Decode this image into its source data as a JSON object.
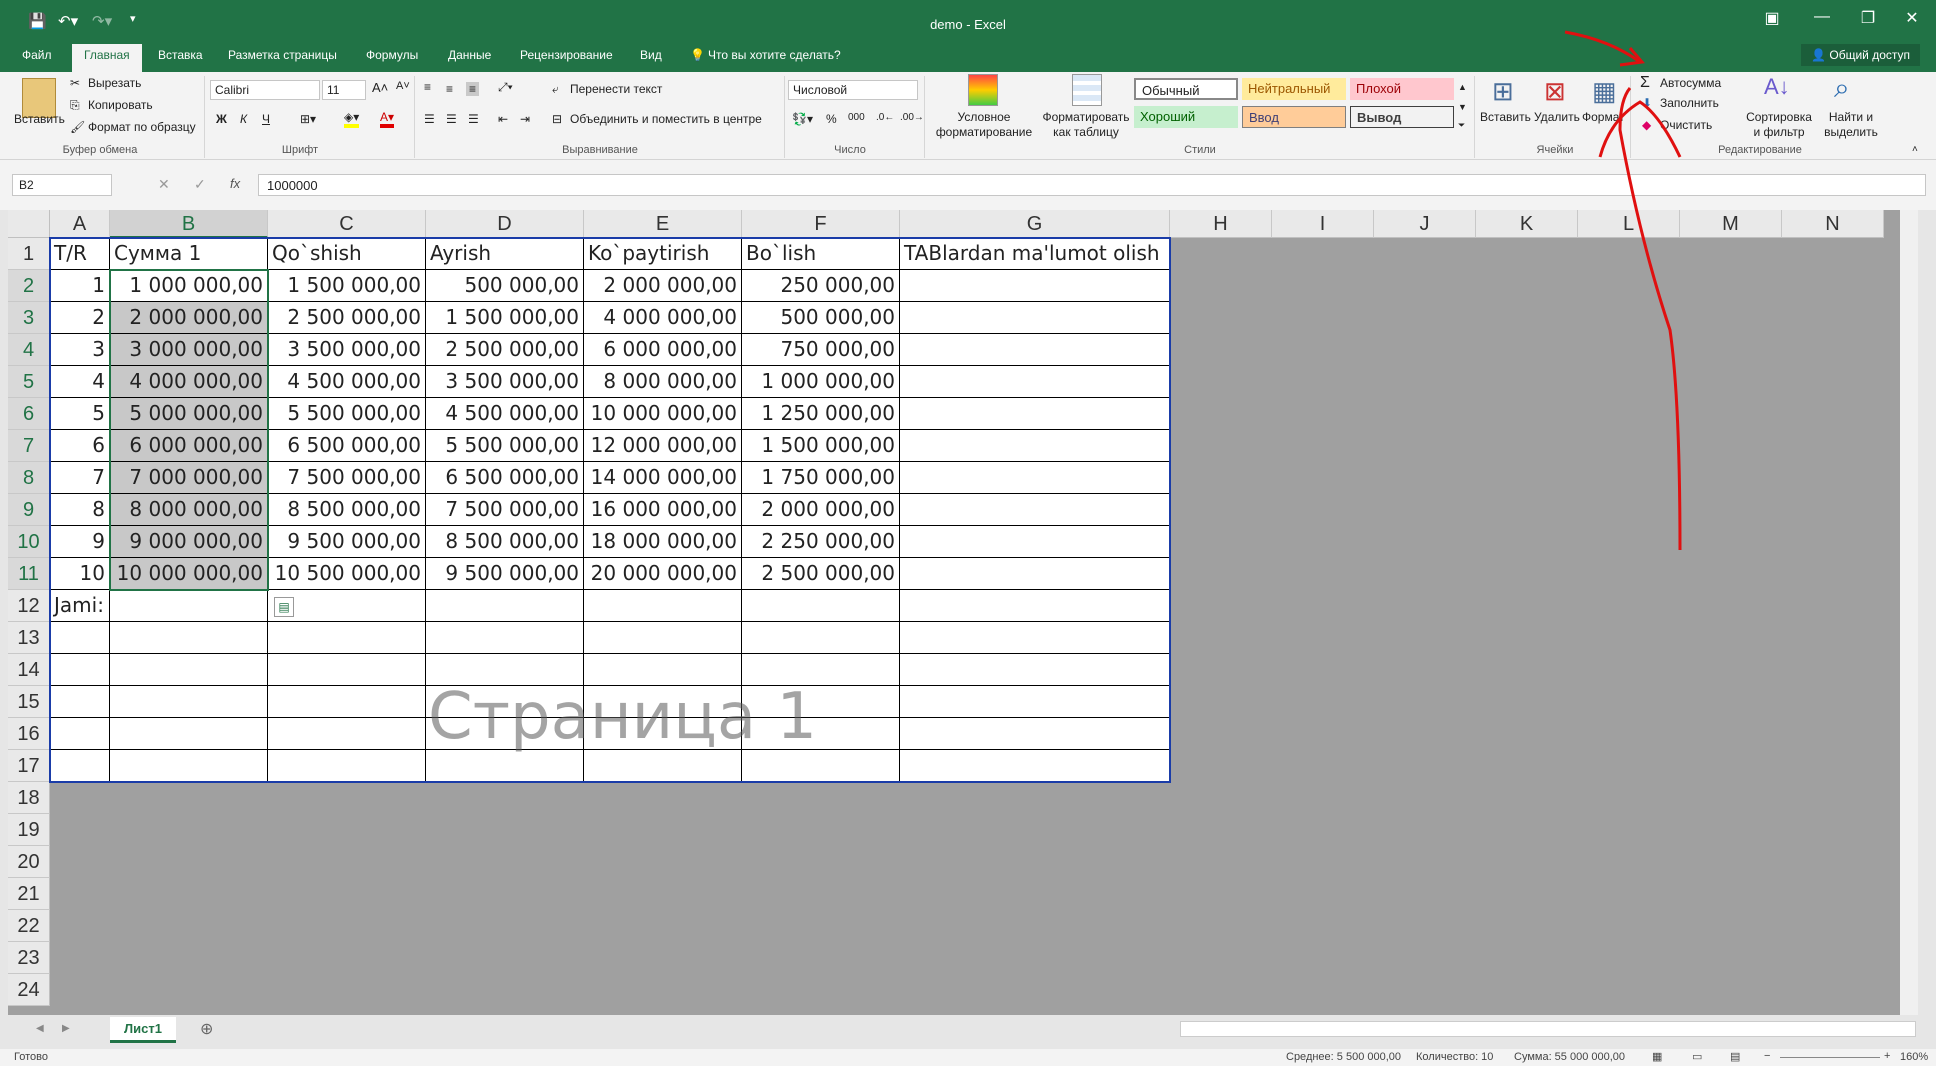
{
  "window": {
    "title": "demo - Excel",
    "share_label": "Общий доступ",
    "tell_me": "Что вы хотите сделать?"
  },
  "tabs": [
    "Файл",
    "Главная",
    "Вставка",
    "Разметка страницы",
    "Формулы",
    "Данные",
    "Рецензирование",
    "Вид"
  ],
  "ribbon": {
    "clipboard": {
      "paste": "Вставить",
      "cut": "Вырезать",
      "copy": "Копировать",
      "format_painter": "Формат по образцу",
      "label": "Буфер обмена"
    },
    "font": {
      "name": "Calibri",
      "size": "11",
      "label": "Шрифт",
      "bold": "Ж",
      "italic": "К",
      "underline": "Ч"
    },
    "alignment": {
      "wrap": "Перенести текст",
      "merge": "Объединить и поместить в центре",
      "label": "Выравнивание"
    },
    "number": {
      "format": "Числовой",
      "label": "Число",
      "percent": "%",
      "thousands": "000"
    },
    "styles": {
      "conditional": "Условное форматирование",
      "as_table": "Форматировать как таблицу",
      "normal": "Обычный",
      "neutral": "Нейтральный",
      "bad": "Плохой",
      "good": "Хороший",
      "input": "Ввод",
      "output": "Вывод",
      "label": "Стили"
    },
    "cells": {
      "insert": "Вставить",
      "delete": "Удалить",
      "format": "Формат",
      "label": "Ячейки"
    },
    "editing": {
      "autosum": "Автосумма",
      "fill": "Заполнить",
      "clear": "Очистить",
      "sort": "Сортировка и фильтр",
      "find": "Найти и выделить",
      "label": "Редактирование"
    }
  },
  "formula_bar": {
    "name_box": "B2",
    "value": "1000000",
    "fx": "fx"
  },
  "columns": [
    "A",
    "B",
    "C",
    "D",
    "E",
    "F",
    "G",
    "H",
    "I",
    "J",
    "K",
    "L",
    "M",
    "N"
  ],
  "rows": [
    "1",
    "2",
    "3",
    "4",
    "5",
    "6",
    "7",
    "8",
    "9",
    "10",
    "11",
    "12",
    "13",
    "14",
    "15",
    "16",
    "17",
    "18",
    "19",
    "20",
    "21",
    "22",
    "23",
    "24"
  ],
  "headers": [
    "T/R",
    "Сумма 1",
    "Qo`shish",
    "Ayrish",
    "Ko`paytirish",
    "Bo`lish",
    "TABlardan ma'lumot olish"
  ],
  "table": [
    [
      "1",
      "1 000 000,00",
      "1 500 000,00",
      "500 000,00",
      "2 000 000,00",
      "250 000,00"
    ],
    [
      "2",
      "2 000 000,00",
      "2 500 000,00",
      "1 500 000,00",
      "4 000 000,00",
      "500 000,00"
    ],
    [
      "3",
      "3 000 000,00",
      "3 500 000,00",
      "2 500 000,00",
      "6 000 000,00",
      "750 000,00"
    ],
    [
      "4",
      "4 000 000,00",
      "4 500 000,00",
      "3 500 000,00",
      "8 000 000,00",
      "1 000 000,00"
    ],
    [
      "5",
      "5 000 000,00",
      "5 500 000,00",
      "4 500 000,00",
      "10 000 000,00",
      "1 250 000,00"
    ],
    [
      "6",
      "6 000 000,00",
      "6 500 000,00",
      "5 500 000,00",
      "12 000 000,00",
      "1 500 000,00"
    ],
    [
      "7",
      "7 000 000,00",
      "7 500 000,00",
      "6 500 000,00",
      "14 000 000,00",
      "1 750 000,00"
    ],
    [
      "8",
      "8 000 000,00",
      "8 500 000,00",
      "7 500 000,00",
      "16 000 000,00",
      "2 000 000,00"
    ],
    [
      "9",
      "9 000 000,00",
      "9 500 000,00",
      "8 500 000,00",
      "18 000 000,00",
      "2 250 000,00"
    ],
    [
      "10",
      "10 000 000,00",
      "10 500 000,00",
      "9 500 000,00",
      "20 000 000,00",
      "2 500 000,00"
    ]
  ],
  "total_label": "Jami:",
  "watermark": "Страница 1",
  "sheet_tab": "Лист1",
  "status": {
    "ready": "Готово",
    "average": "Среднее: 5 500 000,00",
    "count": "Количество: 10",
    "sum": "Сумма: 55 000 000,00",
    "zoom": "160%"
  },
  "colors": {
    "brand": "#217346",
    "annotation": "#e01010"
  }
}
